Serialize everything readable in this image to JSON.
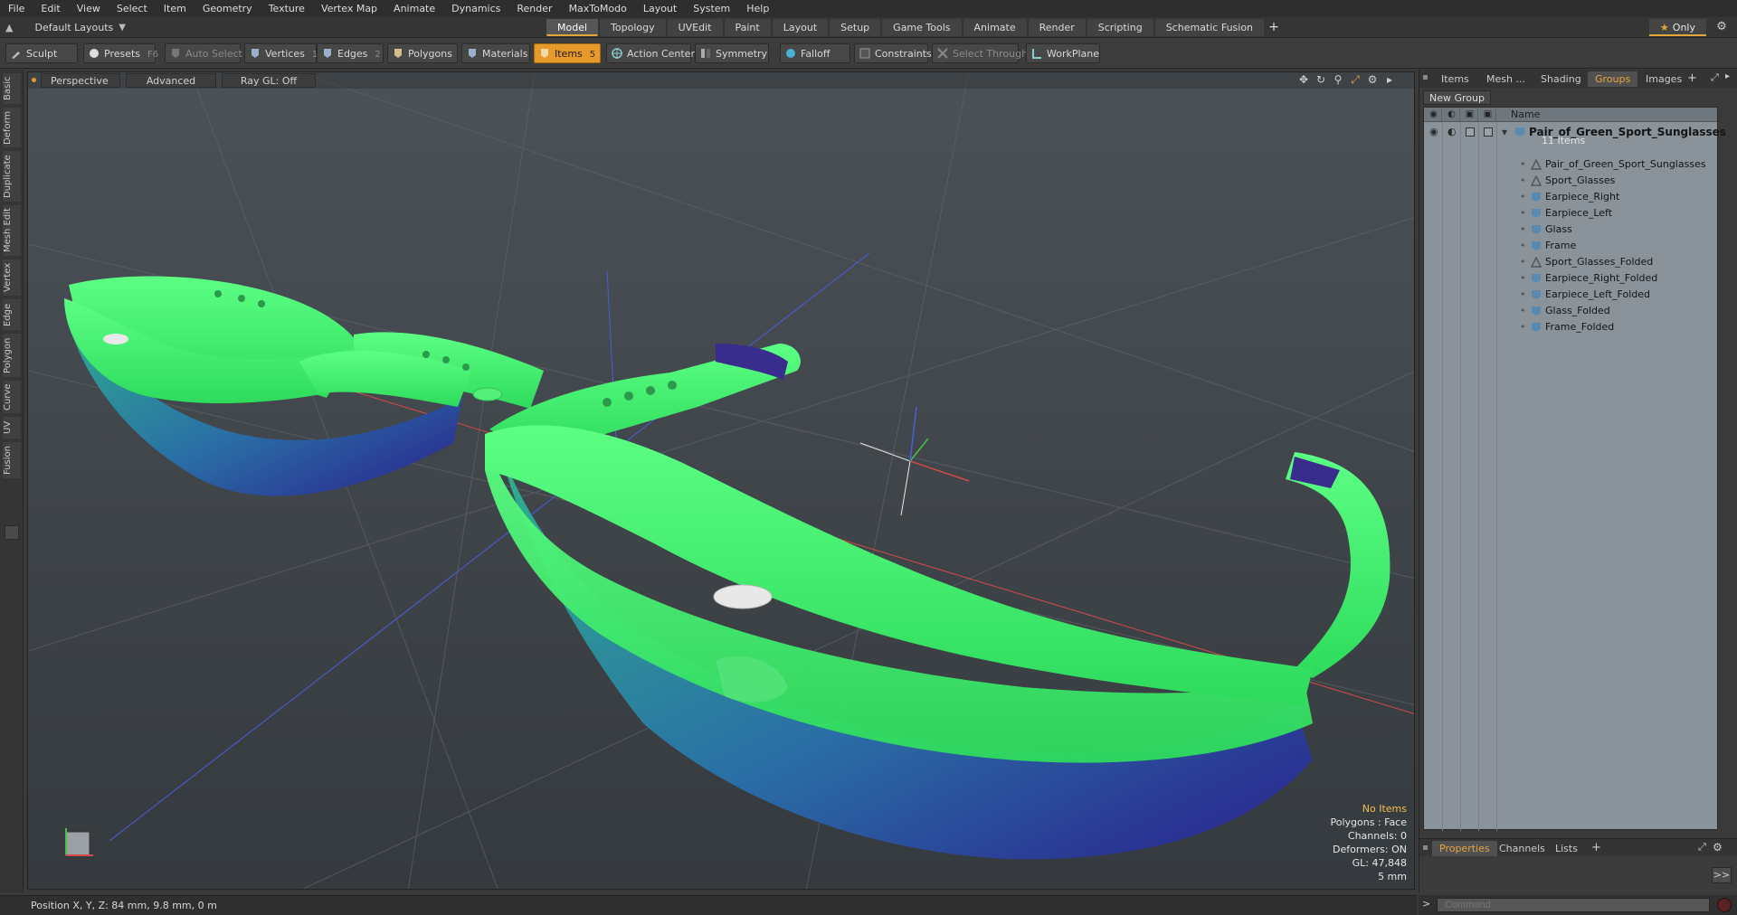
{
  "menu": [
    "File",
    "Edit",
    "View",
    "Select",
    "Item",
    "Geometry",
    "Texture",
    "Vertex Map",
    "Animate",
    "Dynamics",
    "Render",
    "MaxToModo",
    "Layout",
    "System",
    "Help"
  ],
  "layout_select": "Default Layouts",
  "tabs": [
    "Model",
    "Topology",
    "UVEdit",
    "Paint",
    "Layout",
    "Setup",
    "Game Tools",
    "Animate",
    "Render",
    "Scripting",
    "Schematic Fusion"
  ],
  "active_tab": "Model",
  "tab_add": "+",
  "only_label": "Only",
  "toolbar": {
    "sculpt": "Sculpt",
    "presets": "Presets",
    "presets_key": "F6",
    "auto_select": "Auto Select",
    "vertices": "Vertices",
    "vertices_key": "1",
    "edges": "Edges",
    "edges_key": "2",
    "polygons": "Polygons",
    "materials": "Materials",
    "items": "Items",
    "items_key": "5",
    "action_center": "Action Center",
    "symmetry": "Symmetry",
    "falloff": "Falloff",
    "constraints": "Constraints",
    "select_through": "Select Through",
    "workplane": "WorkPlane"
  },
  "left_tabs": [
    "Basic",
    "Deform",
    "Duplicate",
    "Mesh Edit",
    "Vertex",
    "Edge",
    "Polygon",
    "Curve",
    "UV",
    "Fusion"
  ],
  "viewport": {
    "perspective": "Perspective",
    "advanced": "Advanced",
    "raygl": "Ray GL: Off",
    "info": {
      "no_items": "No Items",
      "polygons": "Polygons : Face",
      "channels": "Channels: 0",
      "deformers": "Deformers: ON",
      "gl": "GL: 47,848",
      "unit": "5 mm"
    },
    "colors": {
      "frame": "#3cf26a",
      "lens_top": "#2fb38c",
      "lens_bottom": "#2a1f8c",
      "axis_x": "#d24a4a",
      "axis_y": "#48c048",
      "axis_z": "#4a5ed8"
    }
  },
  "right_panel": {
    "tabs": [
      "Items",
      "Mesh ...",
      "Shading",
      "Groups",
      "Images"
    ],
    "active_tab": "Groups",
    "new_group": "New Group",
    "name_header": "Name",
    "root": {
      "name": "Pair_of_Green_Sport_Sunglasses",
      "sub": "11 Items"
    },
    "items": [
      {
        "label": "Pair_of_Green_Sport_Sunglasses",
        "icon": "locator-icon"
      },
      {
        "label": "Sport_Glasses",
        "icon": "locator-icon"
      },
      {
        "label": "Earpiece_Right",
        "icon": "mesh-icon"
      },
      {
        "label": "Earpiece_Left",
        "icon": "mesh-icon"
      },
      {
        "label": "Glass",
        "icon": "mesh-icon"
      },
      {
        "label": "Frame",
        "icon": "mesh-icon"
      },
      {
        "label": "Sport_Glasses_Folded",
        "icon": "locator-icon"
      },
      {
        "label": "Earpiece_Right_Folded",
        "icon": "mesh-icon"
      },
      {
        "label": "Earpiece_Left_Folded",
        "icon": "mesh-icon"
      },
      {
        "label": "Glass_Folded",
        "icon": "mesh-icon"
      },
      {
        "label": "Frame_Folded",
        "icon": "mesh-icon"
      }
    ],
    "bottom_tabs": [
      "Properties",
      "Channels",
      "Lists"
    ],
    "bottom_active": "Properties",
    "expand": ">>"
  },
  "status": "Position X, Y, Z:  84 mm, 9.8 mm, 0 m",
  "command_placeholder": "Command"
}
